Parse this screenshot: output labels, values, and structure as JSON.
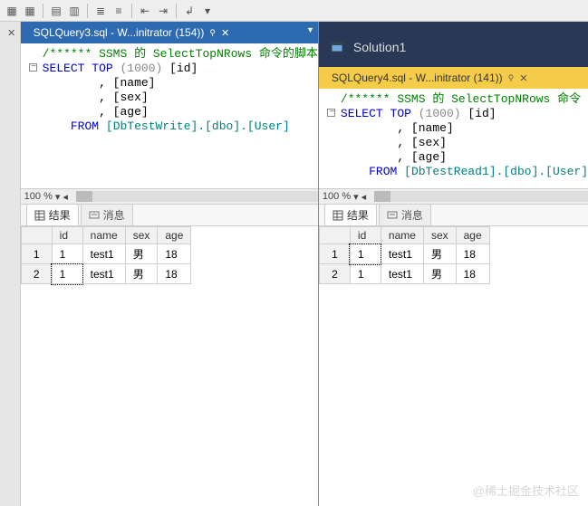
{
  "toolbar": {
    "buttons": [
      "grid",
      "grid2",
      "sep",
      "grid3",
      "grid4",
      "sep",
      "list",
      "indent",
      "sep",
      "outdent-left",
      "outdent-right",
      "sep",
      "wrap",
      "arrow"
    ]
  },
  "left": {
    "tab_title": "SQLQuery3.sql - W...initrator (154))",
    "sql": {
      "comment": "/****** SSMS 的 SelectTopNRows 命令的脚本",
      "select": "SELECT",
      "top": "TOP",
      "topnum": "(1000)",
      "col_id": "[id]",
      "cols": [
        ", [name]",
        ", [sex]",
        ", [age]"
      ],
      "from": "FROM",
      "obj": "[DbTestWrite].[dbo].[User]"
    },
    "zoom": "100 %",
    "results_tabs": {
      "results": "结果",
      "messages": "消息"
    },
    "grid": {
      "headers": [
        "id",
        "name",
        "sex",
        "age"
      ],
      "rows": [
        {
          "n": "1",
          "id": "1",
          "name": "test1",
          "sex": "男",
          "age": "18"
        },
        {
          "n": "2",
          "id": "1",
          "name": "test1",
          "sex": "男",
          "age": "18"
        }
      ]
    }
  },
  "right": {
    "solution_label": "Solution1",
    "tab_title": "SQLQuery4.sql - W...initrator (141))",
    "sql": {
      "comment": "/****** SSMS 的 SelectTopNRows 命令",
      "select": "SELECT",
      "top": "TOP",
      "topnum": "(1000)",
      "col_id": "[id]",
      "cols": [
        ", [name]",
        ", [sex]",
        ", [age]"
      ],
      "from": "FROM",
      "obj": "[DbTestRead1].[dbo].[User]"
    },
    "zoom": "100 %",
    "results_tabs": {
      "results": "结果",
      "messages": "消息"
    },
    "grid": {
      "headers": [
        "id",
        "name",
        "sex",
        "age"
      ],
      "rows": [
        {
          "n": "1",
          "id": "1",
          "name": "test1",
          "sex": "男",
          "age": "18"
        },
        {
          "n": "2",
          "id": "1",
          "name": "test1",
          "sex": "男",
          "age": "18"
        }
      ]
    }
  },
  "watermark": "@稀土掘金技术社区"
}
